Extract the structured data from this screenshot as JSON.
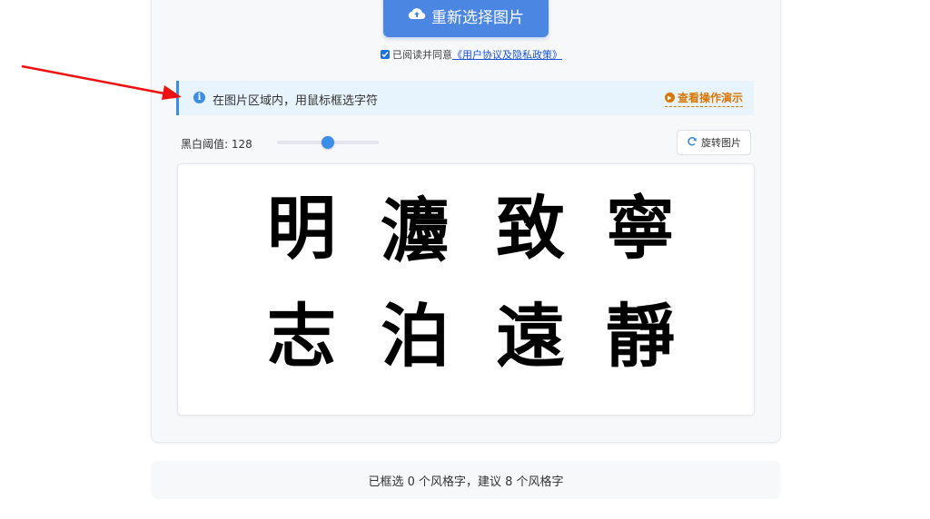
{
  "upload": {
    "label": "重新选择图片",
    "icon": "cloud-upload-icon"
  },
  "agreement": {
    "prefix": "已阅读并同意",
    "link": "《用户协议及隐私政策》",
    "checked": true
  },
  "info": {
    "text": "在图片区域内，用鼠标框选字符",
    "demo_link": "查看操作演示"
  },
  "threshold": {
    "label": "黑白阈值: 128",
    "value": 128,
    "min": 0,
    "max": 255
  },
  "rotate": {
    "label": "旋转图片"
  },
  "image": {
    "row1": [
      "明",
      "灋",
      "致",
      "寧"
    ],
    "row2": [
      "志",
      "泊",
      "遠",
      "靜"
    ]
  },
  "footer": {
    "text": "已框选 0 个风格字，建议 8 个风格字"
  },
  "colors": {
    "primary": "#4a86e2",
    "info_bg": "#e8f4fd",
    "accent": "#3a8ee6",
    "demo": "#d97706",
    "annotation_arrow": "#ee1111"
  }
}
